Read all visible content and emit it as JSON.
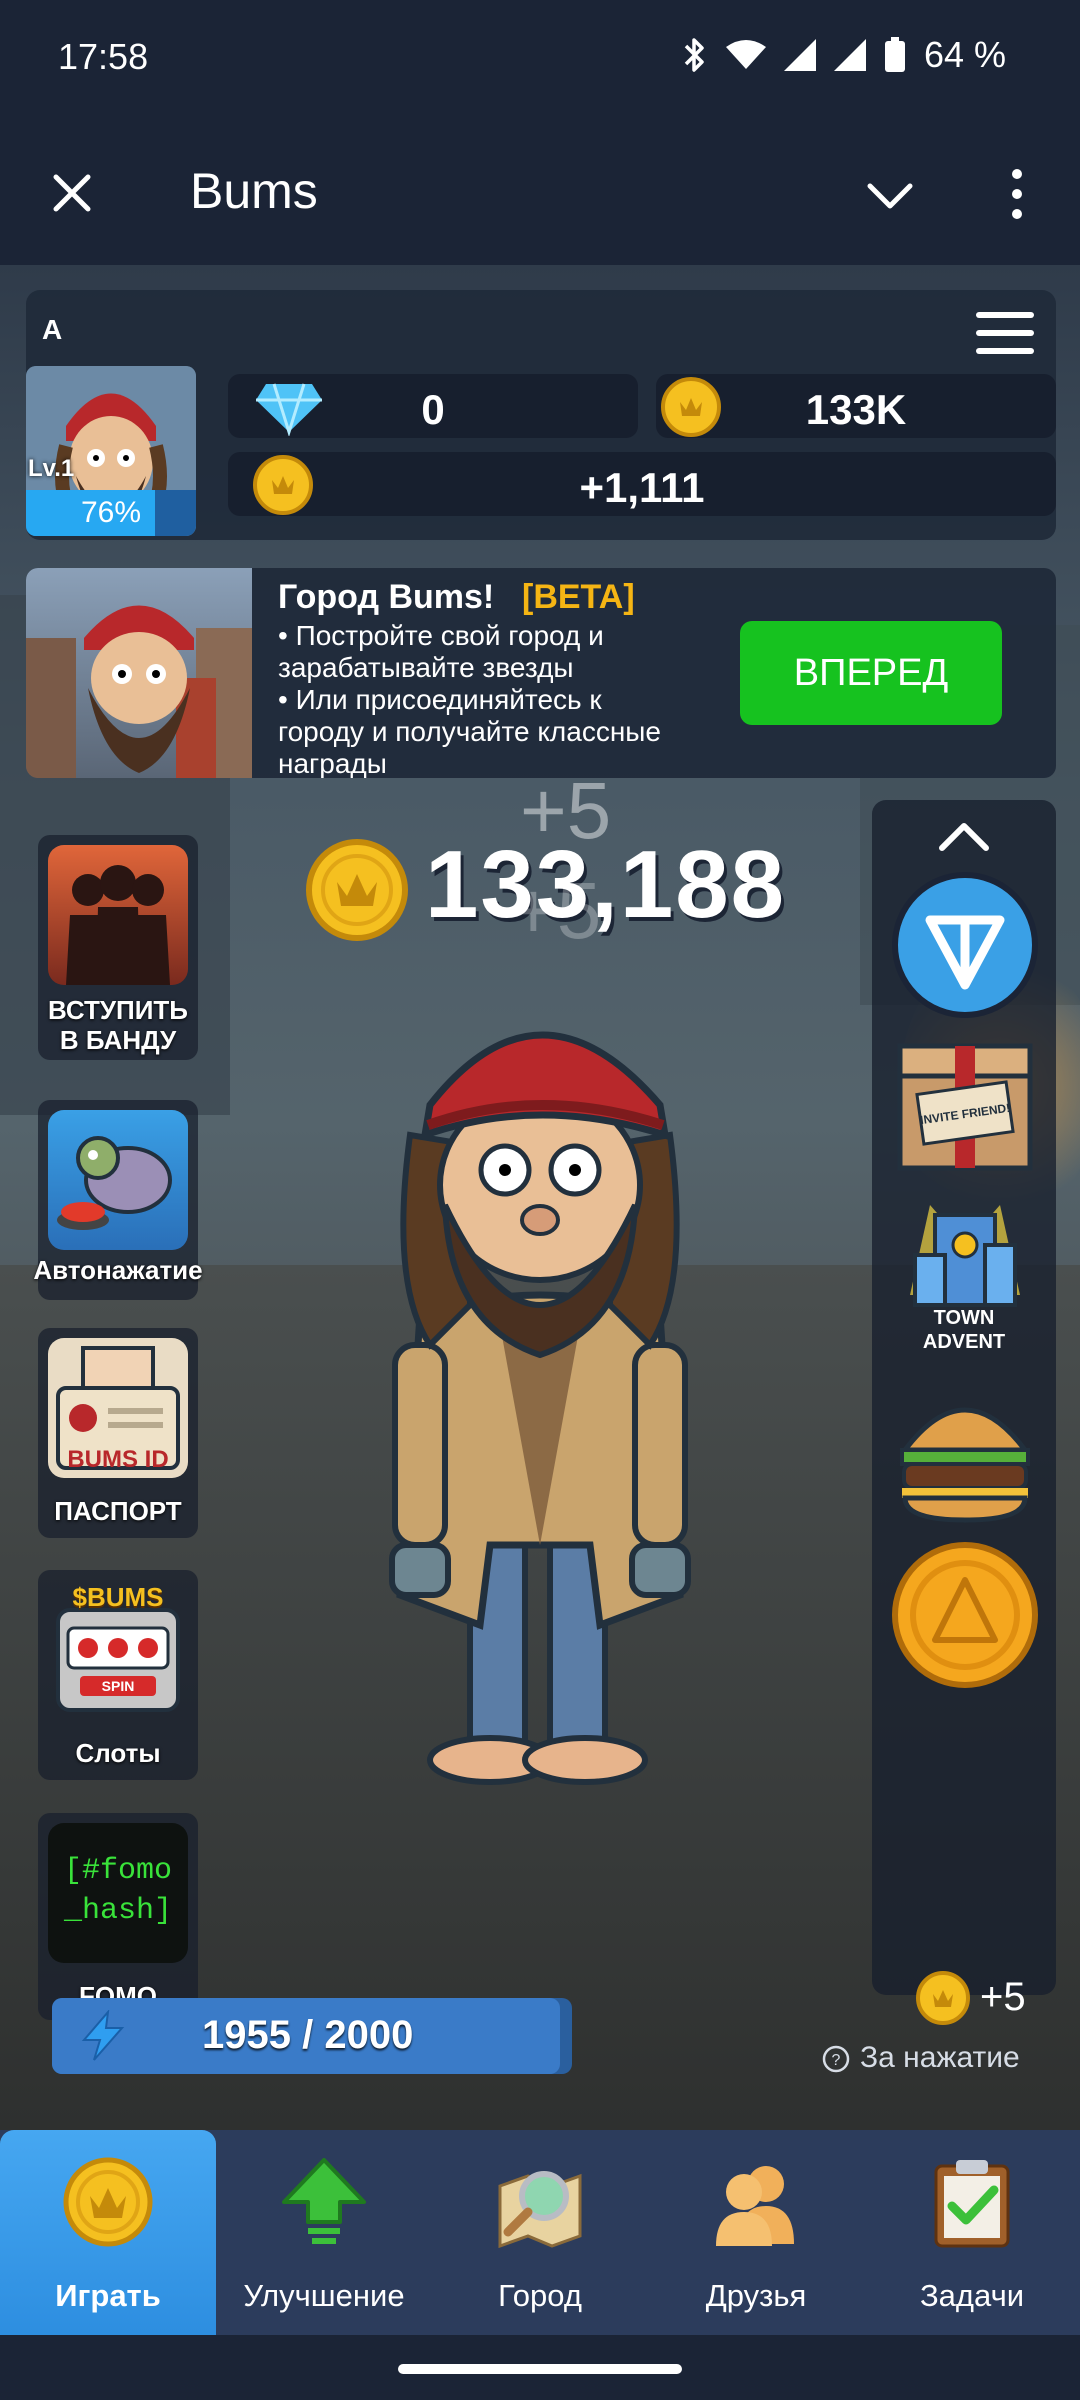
{
  "status_bar": {
    "time": "17:58",
    "battery": "64 %",
    "icons": [
      "bluetooth-icon",
      "wifi-icon",
      "signal-icon",
      "signal-icon",
      "battery-icon"
    ]
  },
  "app_bar": {
    "title": "Bums",
    "icons": [
      "close-icon",
      "chevron-down-icon",
      "more-vert-icon"
    ]
  },
  "profile": {
    "letter": "A",
    "level": "Lv.1",
    "level_progress": 0.76,
    "level_percent": "76%",
    "gems": "0",
    "coins_short": "133K",
    "per_hour": "+1,111"
  },
  "town_banner": {
    "title": "Город Bums!",
    "beta": "[BETA]",
    "line1": "• Постройте свой город и",
    "line2": "зарабатывайте звезды",
    "line3": "• Или присоединяйтесь к",
    "line4": "городу и получайте классные",
    "line5": "награды",
    "button": "ВПЕРЕД"
  },
  "balance": "133,188",
  "floating_bonus": "+5",
  "left_features": [
    {
      "line1": "ВСТУПИТЬ",
      "line2": "В БАНДУ"
    },
    {
      "line1": "Автонажатие",
      "line2": ""
    },
    {
      "line1": "ПАСПОРТ",
      "line2": ""
    },
    {
      "line1": "Слоты",
      "line2": ""
    },
    {
      "line1": "FOMO",
      "line2": ""
    }
  ],
  "feature_texts": {
    "passport_card": "BUMS ID",
    "slots_brand": "$BUMS",
    "slots_spin": "SPIN",
    "fomo_code": "[#fomo\n_hash]"
  },
  "right_panel": {
    "town_advent_line1": "TOWN",
    "town_advent_line2": "ADVENT",
    "invite_box_text": "INVITE FRIEND!"
  },
  "energy": {
    "text": "1955 / 2000",
    "current": 1955,
    "max": 2000
  },
  "per_tap": {
    "value": "+5",
    "label": "За нажатие"
  },
  "bottom_nav": [
    {
      "label": "Играть",
      "active": true
    },
    {
      "label": "Улучшение",
      "active": false
    },
    {
      "label": "Город",
      "active": false
    },
    {
      "label": "Друзья",
      "active": false
    },
    {
      "label": "Задачи",
      "active": false
    }
  ],
  "colors": {
    "header_bg": "#1b2436",
    "accent_green": "#16c21f",
    "beta_yellow": "#f5b514",
    "nav_active": "#2d8ee0",
    "nav_bg": "#2c3c5c",
    "coin_gold": "#f5c020"
  }
}
